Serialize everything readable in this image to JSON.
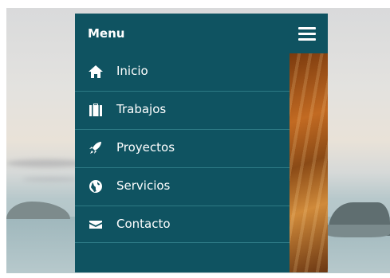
{
  "menu": {
    "title": "Menu",
    "items": [
      {
        "label": "Inicio",
        "icon": "home-icon"
      },
      {
        "label": "Trabajos",
        "icon": "briefcase-icon"
      },
      {
        "label": "Proyectos",
        "icon": "rocket-icon"
      },
      {
        "label": "Servicios",
        "icon": "globe-icon"
      },
      {
        "label": "Contacto",
        "icon": "envelope-icon"
      }
    ]
  },
  "colors": {
    "menu_bg": "#0f5361",
    "divider": "#2d7a85",
    "text": "#ffffff"
  }
}
